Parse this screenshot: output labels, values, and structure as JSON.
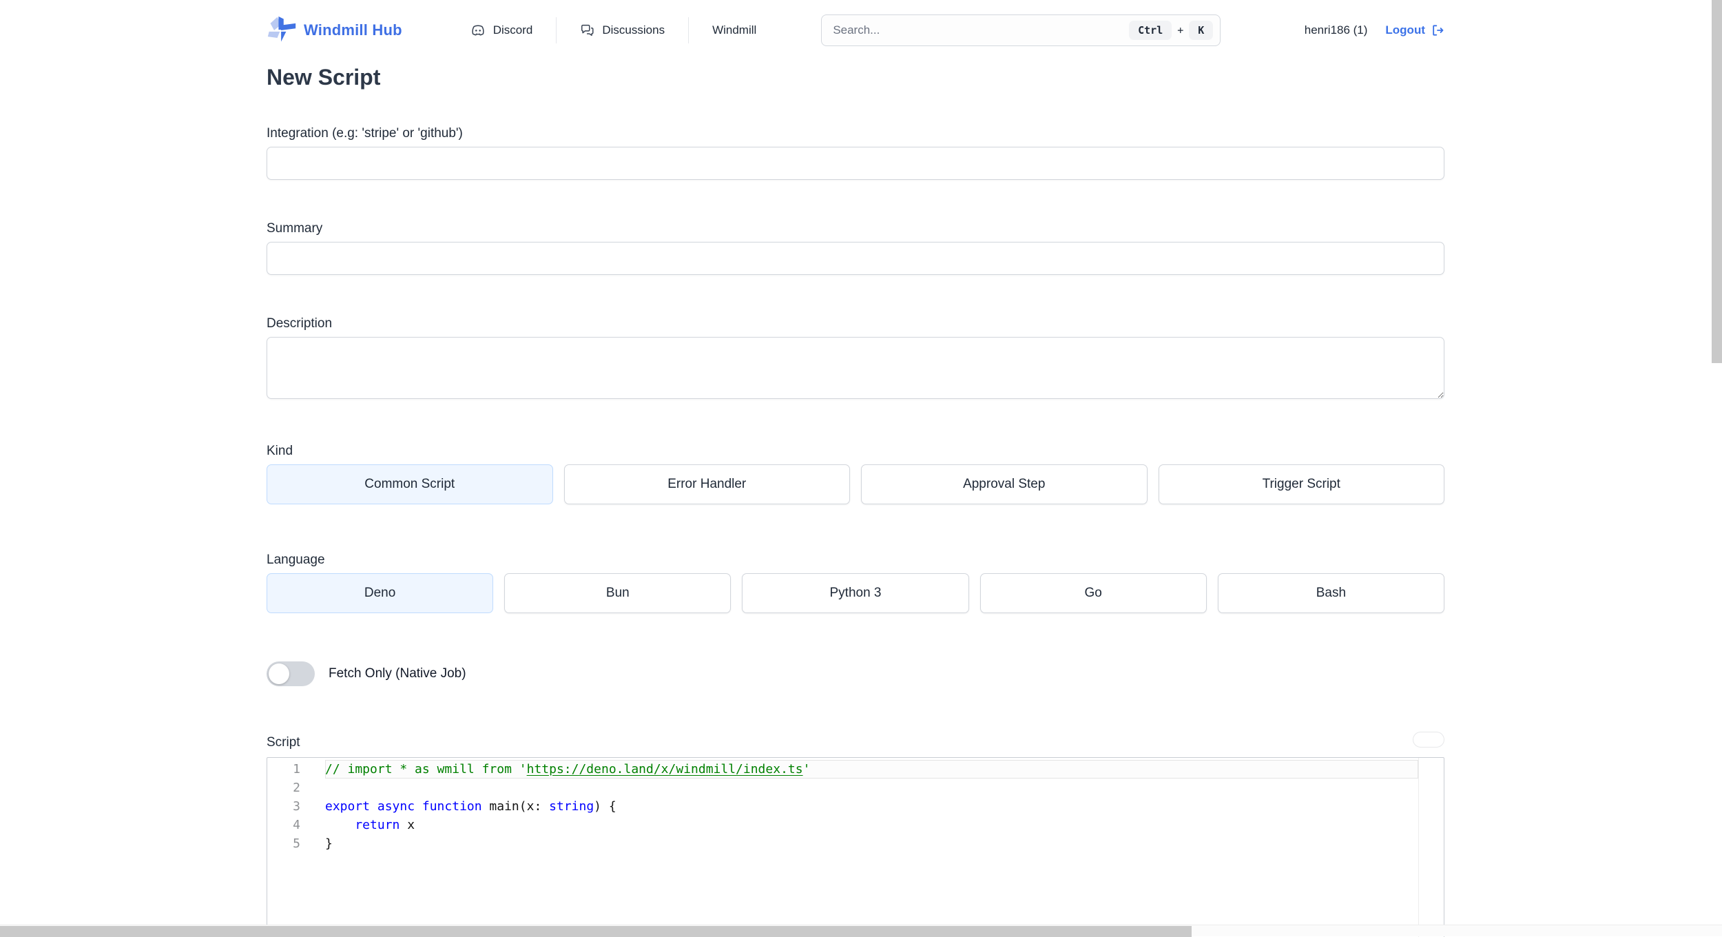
{
  "header": {
    "brand": "Windmill Hub",
    "nav": {
      "discord": "Discord",
      "discussions": "Discussions",
      "windmill": "Windmill"
    },
    "search": {
      "placeholder": "Search...",
      "key_ctrl": "Ctrl",
      "key_plus": "+",
      "key_k": "K"
    },
    "user": {
      "name": "henri186 (1)",
      "logout": "Logout"
    }
  },
  "page": {
    "title": "New Script"
  },
  "form": {
    "integration": {
      "label": "Integration (e.g: 'stripe' or 'github')",
      "value": ""
    },
    "summary": {
      "label": "Summary",
      "value": ""
    },
    "description": {
      "label": "Description",
      "value": ""
    },
    "kind": {
      "label": "Kind",
      "options": [
        "Common Script",
        "Error Handler",
        "Approval Step",
        "Trigger Script"
      ],
      "selected": "Common Script"
    },
    "language": {
      "label": "Language",
      "options": [
        "Deno",
        "Bun",
        "Python 3",
        "Go",
        "Bash"
      ],
      "selected": "Deno"
    },
    "fetch_only": {
      "label": "Fetch Only (Native Job)",
      "enabled": false
    },
    "script": {
      "label": "Script"
    }
  },
  "editor": {
    "lines": {
      "l1": {
        "num": "1",
        "c1": "// import * as wmill from '",
        "link": "https://deno.land/x/windmill/index.ts",
        "c2": "'"
      },
      "l2": {
        "num": "2"
      },
      "l3": {
        "num": "3",
        "kw": "export async function ",
        "fn": "main",
        "p1": "(x: ",
        "type": "string",
        "p2": ") {"
      },
      "l4": {
        "num": "4",
        "kw": "    return ",
        "val": "x"
      },
      "l5": {
        "num": "5",
        "text": "}"
      }
    }
  },
  "colors": {
    "accent": "#3b72e8",
    "selected_bg": "#eff6ff",
    "selected_border": "#bfdbfe",
    "code_keyword": "#0000ff",
    "code_comment": "#008000"
  }
}
